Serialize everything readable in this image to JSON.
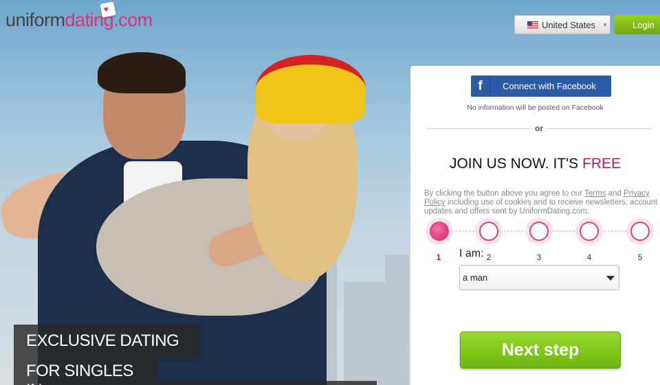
{
  "header": {
    "logo_part1": "uniform",
    "logo_part2": "dating.com",
    "country_selector": "United States",
    "login_label": "Login"
  },
  "hero": {
    "slogan_line1": "EXCLUSIVE DATING",
    "slogan_line2": "FOR SINGLES IN"
  },
  "join_panel": {
    "facebook_button": "Connect with Facebook",
    "facebook_note": "No information will be posted on Facebook",
    "or_label": "or",
    "title_part1": "JOIN US NOW. IT'S ",
    "title_part2": "FREE",
    "terms_text_1": "By clicking the button above you agree to our ",
    "terms_link": "Terms",
    "terms_text_2": " and ",
    "privacy_link": "Privacy Policy",
    "terms_text_3": " including use of cookies and to receive newsletters, account updates and offers sent by UniformDating.com.",
    "steps": [
      "1",
      "2",
      "3",
      "4",
      "5"
    ],
    "active_step": 1,
    "iam_label": "I am:",
    "iam_selected": "a man",
    "next_button": "Next step"
  },
  "colors": {
    "brand_pink": "#c3175d",
    "facebook_blue": "#2d5ca7",
    "green_button": "#7cc11a"
  }
}
